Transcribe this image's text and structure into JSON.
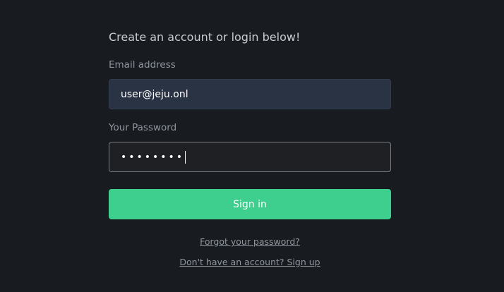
{
  "form": {
    "heading": "Create an account or login below!",
    "email_label": "Email address",
    "email_value": "user@jeju.onl",
    "password_label": "Your Password",
    "password_value": "••••••••",
    "sign_in_label": "Sign in",
    "forgot_link": "Forgot your password?",
    "signup_link": "Don't have an account? Sign up"
  },
  "colors": {
    "background": "#181b20",
    "accent": "#3ecf8e",
    "email_field_bg": "#2a3344"
  }
}
